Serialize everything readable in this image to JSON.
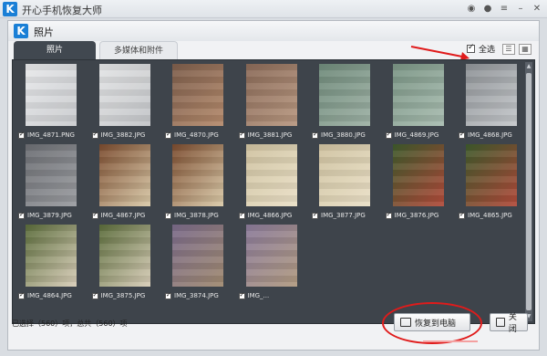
{
  "app": {
    "title": "开心手机恢复大师",
    "logo_letter": "K"
  },
  "dialog": {
    "title": "照片",
    "logo_letter": "K"
  },
  "tabs": [
    {
      "label": "照片",
      "active": true
    },
    {
      "label": "多媒体和附件",
      "active": false
    }
  ],
  "toolbar": {
    "select_all_label": "全选",
    "select_all_checked": true
  },
  "photos": [
    {
      "name": "IMG_4871.PNG",
      "tone": "#e7e8ea",
      "accent": "#c9cbce",
      "checked": true
    },
    {
      "name": "IMG_3882.JPG",
      "tone": "#e3e4e5",
      "accent": "#c2c4c7",
      "checked": true
    },
    {
      "name": "IMG_4870.JPG",
      "tone": "#7d5e4c",
      "accent": "#b48a6c",
      "checked": true
    },
    {
      "name": "IMG_3881.JPG",
      "tone": "#8a6a58",
      "accent": "#b79780",
      "checked": true
    },
    {
      "name": "IMG_3880.JPG",
      "tone": "#6f8a7a",
      "accent": "#9db0a4",
      "checked": true
    },
    {
      "name": "IMG_4869.JPG",
      "tone": "#7a9484",
      "accent": "#a8bcb0",
      "checked": true
    },
    {
      "name": "IMG_4868.JPG",
      "tone": "#8e9296",
      "accent": "#c4c7ca",
      "checked": true
    },
    {
      "name": "IMG_3879.JPG",
      "tone": "#6c6e73",
      "accent": "#9a9ca0",
      "checked": true
    },
    {
      "name": "IMG_4867.JPG",
      "tone": "#7a4b2e",
      "accent": "#d9c9a8",
      "checked": true
    },
    {
      "name": "IMG_3878.JPG",
      "tone": "#7a4b2e",
      "accent": "#d9c9a8",
      "checked": true
    },
    {
      "name": "IMG_4866.JPG",
      "tone": "#cfc2a0",
      "accent": "#e9dfc6",
      "checked": true
    },
    {
      "name": "IMG_3877.JPG",
      "tone": "#cfc2a0",
      "accent": "#e9dfc6",
      "checked": true
    },
    {
      "name": "IMG_3876.JPG",
      "tone": "#3e5a2c",
      "accent": "#b24a3a",
      "checked": true
    },
    {
      "name": "IMG_4865.JPG",
      "tone": "#3e5a2c",
      "accent": "#b24a3a",
      "checked": true
    },
    {
      "name": "IMG_4864.JPG",
      "tone": "#5a6b3a",
      "accent": "#d8cdb8",
      "checked": true
    },
    {
      "name": "IMG_3875.JPG",
      "tone": "#5a6b3a",
      "accent": "#d8cdb8",
      "checked": true
    },
    {
      "name": "IMG_3874.JPG",
      "tone": "#7a6a8a",
      "accent": "#a08a70",
      "checked": true
    },
    {
      "name": "IMG_...",
      "tone": "#8a7a9a",
      "accent": "#b09a80",
      "checked": true
    }
  ],
  "status": {
    "text": "已选择（560）项，总共（560）项"
  },
  "buttons": {
    "recover_label": "恢复到电脑",
    "close_label": "关闭"
  },
  "colors": {
    "accent_blue": "#1a7fd6",
    "panel_dark": "#3e444b",
    "annotation_red": "#e01b1b"
  }
}
